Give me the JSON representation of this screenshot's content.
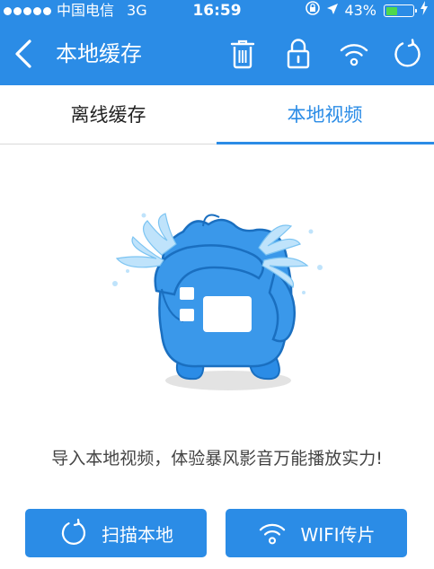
{
  "status_bar": {
    "carrier": "中国电信",
    "network": "3G",
    "time": "16:59",
    "battery": "43%",
    "battery_level": 0.43
  },
  "nav": {
    "title": "本地缓存",
    "icons": [
      "back-icon",
      "trash-icon",
      "lock-icon",
      "wifi-icon",
      "refresh-icon"
    ]
  },
  "tabs": {
    "offline": "离线缓存",
    "local": "本地视频",
    "active": "local"
  },
  "empty_state": {
    "message": "导入本地视频，体验暴风影音万能播放实力!"
  },
  "actions": {
    "scan_label": "扫描本地",
    "wifi_label": "WIFI传片"
  },
  "colors": {
    "accent": "#2b8ce6",
    "battery_fill": "#4ed84e"
  }
}
